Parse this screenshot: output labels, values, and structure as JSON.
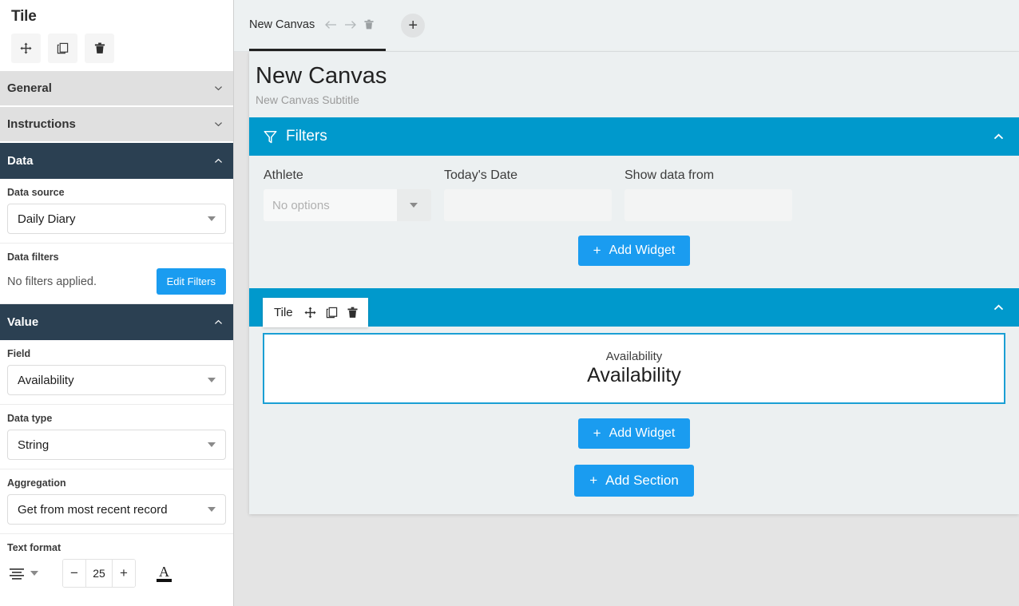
{
  "sidebar": {
    "title": "Tile",
    "tools": [
      {
        "name": "move-icon",
        "label": "Move"
      },
      {
        "name": "duplicate-icon",
        "label": "Duplicate"
      },
      {
        "name": "delete-icon",
        "label": "Delete"
      }
    ],
    "sections": [
      {
        "label": "General",
        "state": "collapsed"
      },
      {
        "label": "Instructions",
        "state": "collapsed"
      },
      {
        "label": "Data",
        "state": "open"
      },
      {
        "label": "Value",
        "state": "open"
      }
    ],
    "data_section": {
      "data_source_label": "Data source",
      "data_source_value": "Daily Diary",
      "data_filters_label": "Data filters",
      "data_filters_note": "No filters applied.",
      "edit_filters_button": "Edit Filters"
    },
    "value_section": {
      "field_label": "Field",
      "field_value": "Availability",
      "data_type_label": "Data type",
      "data_type_value": "String",
      "aggregation_label": "Aggregation",
      "aggregation_value": "Get from most recent record",
      "text_format_label": "Text format",
      "font_size": "25",
      "decrease": "−",
      "increase": "+",
      "text_color_letter": "A"
    }
  },
  "tabbar": {
    "tab_label": "New Canvas",
    "back_icon": "←",
    "forward_icon": "→",
    "add_tab_label": "+"
  },
  "canvas": {
    "title": "New Canvas",
    "subtitle": "New Canvas Subtitle",
    "filters_section": {
      "title": "Filters",
      "fields": [
        {
          "label": "Athlete",
          "type": "select",
          "value": "No options"
        },
        {
          "label": "Today's Date",
          "type": "input",
          "value": ""
        },
        {
          "label": "Show data from",
          "type": "input",
          "value": ""
        }
      ],
      "add_widget_button": "Add Widget"
    },
    "widget_section": {
      "tile_toolbar_label": "Tile",
      "tile_caption": "Availability",
      "tile_value": "Availability",
      "add_widget_button": "Add Widget"
    },
    "add_section_button": "Add Section"
  },
  "colors": {
    "section_blue": "#0099cc",
    "button_blue": "#1a9cf0",
    "sidebar_dark": "#2b4052",
    "tile_border": "#1a9fd4",
    "canvas_bg": "#ecf0f1"
  }
}
